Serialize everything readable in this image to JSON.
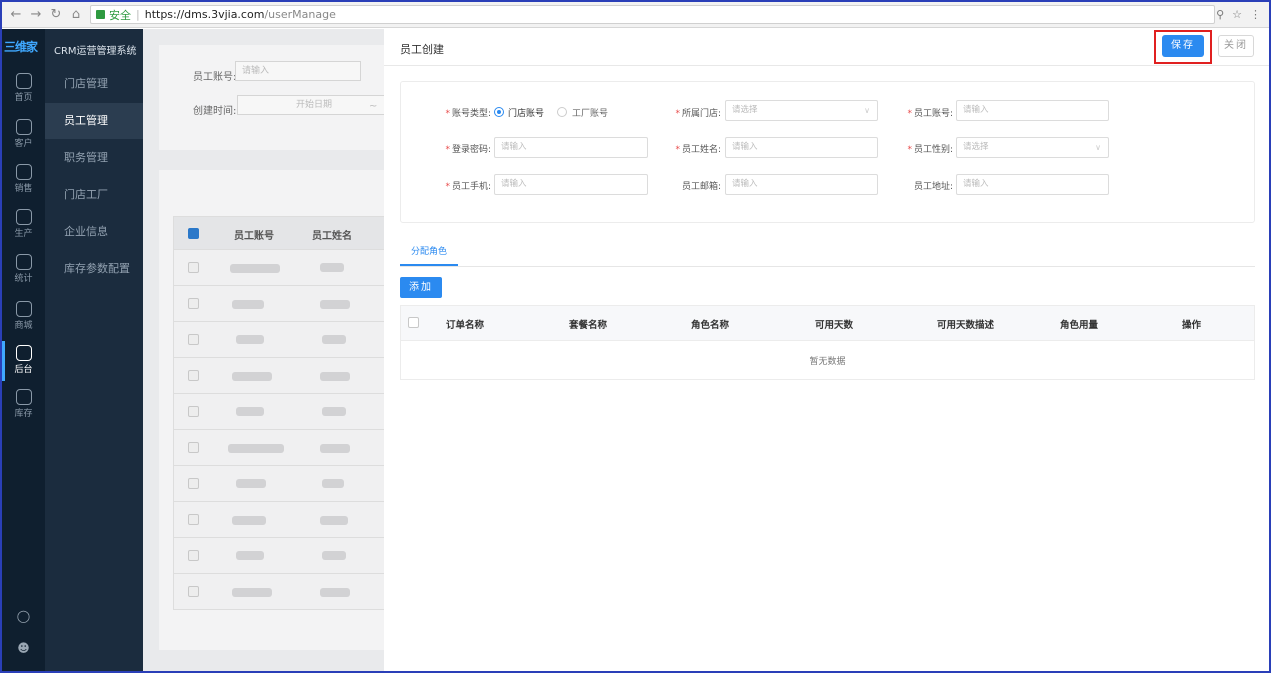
{
  "browser": {
    "secure_label": "安全",
    "url_host": "https://dms.3vjia.com",
    "url_path": "/userManage"
  },
  "sidebar": {
    "logo": "三维家",
    "system_title": "CRM运营管理系统",
    "rail": [
      {
        "label": "首页",
        "icon": "home-icon"
      },
      {
        "label": "客户",
        "icon": "users-icon"
      },
      {
        "label": "销售",
        "icon": "sales-icon"
      },
      {
        "label": "生产",
        "icon": "tools-icon"
      },
      {
        "label": "统计",
        "icon": "chart-doc-icon"
      },
      {
        "label": "商城",
        "icon": "store-doc-icon"
      },
      {
        "label": "后台",
        "icon": "admin-icon"
      },
      {
        "label": "库存",
        "icon": "warehouse-icon"
      }
    ],
    "menu": [
      "门店管理",
      "员工管理",
      "职务管理",
      "门店工厂",
      "企业信息",
      "库存参数配置"
    ]
  },
  "background": {
    "filter": {
      "account_label": "员工账号:",
      "account_placeholder": "请输入",
      "created_label": "创建时间:",
      "start_placeholder": "开始日期",
      "range_sep": "~"
    },
    "table": {
      "col_account": "员工账号",
      "col_name": "员工姓名"
    }
  },
  "drawer": {
    "title": "员工创建",
    "save": "保存",
    "close": "关闭",
    "form": {
      "account_type_label": "账号类型:",
      "account_type_options": [
        "门店账号",
        "工厂账号"
      ],
      "store_label": "所属门店:",
      "store_placeholder": "请选择",
      "emp_account_label": "员工账号:",
      "emp_account_placeholder": "请输入",
      "password_label": "登录密码:",
      "password_placeholder": "请输入",
      "name_label": "员工姓名:",
      "name_placeholder": "请输入",
      "gender_label": "员工性别:",
      "gender_placeholder": "请选择",
      "phone_label": "员工手机:",
      "phone_placeholder": "请输入",
      "email_label": "员工邮箱:",
      "email_placeholder": "请输入",
      "address_label": "员工地址:",
      "address_placeholder": "请输入"
    },
    "tab_label": "分配角色",
    "add_button": "添加",
    "grid": {
      "columns": [
        "订单名称",
        "套餐名称",
        "角色名称",
        "可用天数",
        "可用天数描述",
        "角色用量",
        "操作"
      ],
      "empty_text": "暂无数据"
    }
  }
}
